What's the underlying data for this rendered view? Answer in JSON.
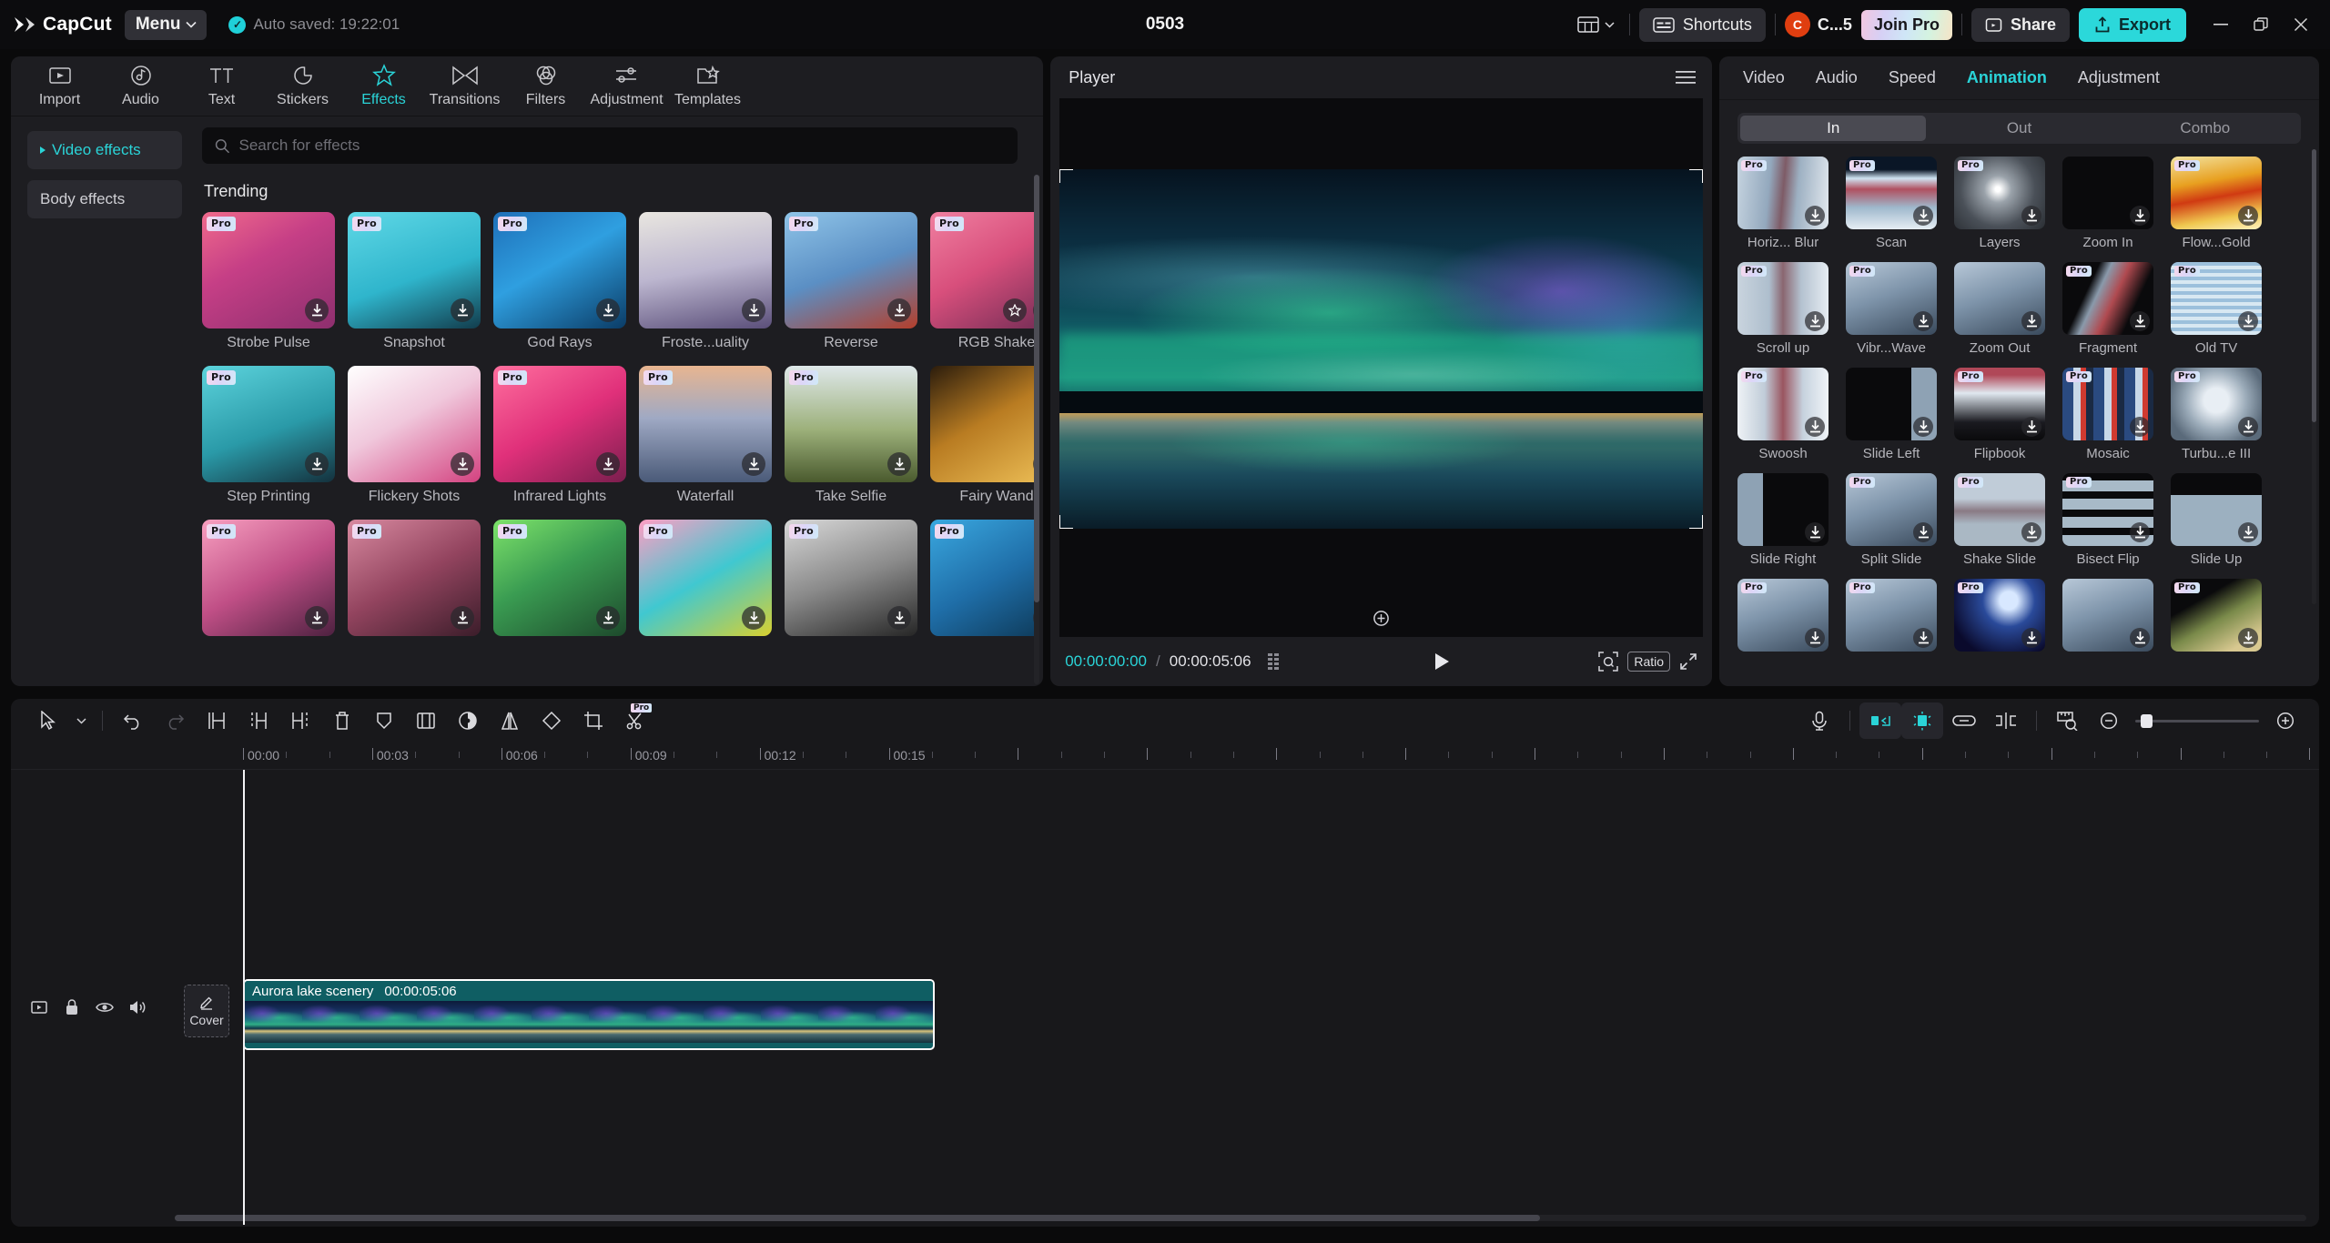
{
  "topbar": {
    "brand": "CapCut",
    "menu_label": "Menu",
    "autosave_text": "Auto saved: 19:22:01",
    "project_title": "0503",
    "shortcuts_label": "Shortcuts",
    "account_initial": "C",
    "account_name": "C...5",
    "join_pro_label": "Join Pro",
    "share_label": "Share",
    "export_label": "Export",
    "accent_cyan": "#2bd8da",
    "avatar_color": "#e03e10"
  },
  "left_panel": {
    "tabs": [
      {
        "label": "Import",
        "icon": "import-icon",
        "active": false
      },
      {
        "label": "Audio",
        "icon": "audio-icon",
        "active": false
      },
      {
        "label": "Text",
        "icon": "text-icon",
        "active": false
      },
      {
        "label": "Stickers",
        "icon": "stickers-icon",
        "active": false
      },
      {
        "label": "Effects",
        "icon": "effects-icon",
        "active": true
      },
      {
        "label": "Transitions",
        "icon": "transitions-icon",
        "active": false
      },
      {
        "label": "Filters",
        "icon": "filters-icon",
        "active": false
      },
      {
        "label": "Adjustment",
        "icon": "adjustment-icon",
        "active": false
      },
      {
        "label": "Templates",
        "icon": "templates-icon",
        "active": false
      }
    ],
    "sidebar": [
      {
        "label": "Video effects",
        "active": true
      },
      {
        "label": "Body effects",
        "active": false
      }
    ],
    "search": {
      "placeholder": "Search for effects",
      "value": "",
      "icon": "search-icon"
    },
    "section_title": "Trending",
    "effects": [
      {
        "name": "Strobe Pulse",
        "pro": true,
        "fav": false,
        "download": true
      },
      {
        "name": "Snapshot",
        "pro": true,
        "fav": false,
        "download": true
      },
      {
        "name": "God Rays",
        "pro": true,
        "fav": false,
        "download": true
      },
      {
        "name": "Froste...uality",
        "pro": false,
        "fav": false,
        "download": true
      },
      {
        "name": "Reverse",
        "pro": true,
        "fav": false,
        "download": true
      },
      {
        "name": "RGB Shake",
        "pro": true,
        "fav": true,
        "download": true
      },
      {
        "name": "Step Printing",
        "pro": true,
        "fav": false,
        "download": true
      },
      {
        "name": "Flickery Shots",
        "pro": false,
        "fav": false,
        "download": true
      },
      {
        "name": "Infrared Lights",
        "pro": true,
        "fav": false,
        "download": true
      },
      {
        "name": "Waterfall",
        "pro": true,
        "fav": false,
        "download": true
      },
      {
        "name": "Take Selfie",
        "pro": true,
        "fav": false,
        "download": true
      },
      {
        "name": "Fairy Wand",
        "pro": false,
        "fav": false,
        "download": true
      },
      {
        "name": "",
        "pro": true,
        "fav": false,
        "download": true
      },
      {
        "name": "",
        "pro": true,
        "fav": false,
        "download": true
      },
      {
        "name": "",
        "pro": true,
        "fav": false,
        "download": true
      },
      {
        "name": "",
        "pro": true,
        "fav": false,
        "download": true
      },
      {
        "name": "",
        "pro": true,
        "fav": false,
        "download": true
      },
      {
        "name": "",
        "pro": true,
        "fav": false,
        "download": true
      }
    ]
  },
  "player": {
    "title": "Player",
    "menu_icon": "hamburger-icon",
    "current_time": "00:00:00:00",
    "time_separator": "/",
    "total_time": "00:00:05:06",
    "grid_icon": "frames-icon",
    "play_icon": "play-icon",
    "quality_icon": "quality-icon",
    "ratio_label": "Ratio",
    "fullscreen_icon": "fullscreen-icon",
    "reset_icon": "reset-icon"
  },
  "right_panel": {
    "tabs": [
      {
        "label": "Video",
        "active": false
      },
      {
        "label": "Audio",
        "active": false
      },
      {
        "label": "Speed",
        "active": false
      },
      {
        "label": "Animation",
        "active": true
      },
      {
        "label": "Adjustment",
        "active": false
      }
    ],
    "segments": [
      {
        "label": "In",
        "active": true
      },
      {
        "label": "Out",
        "active": false
      },
      {
        "label": "Combo",
        "active": false
      }
    ],
    "animations": [
      {
        "name": "Horiz... Blur",
        "pro": true,
        "style": "blur-h"
      },
      {
        "name": "Scan",
        "pro": true,
        "style": "scan"
      },
      {
        "name": "Layers",
        "pro": true,
        "style": "layers"
      },
      {
        "name": "Zoom In",
        "pro": false,
        "style": "zoomin"
      },
      {
        "name": "Flow...Gold",
        "pro": true,
        "style": "gold"
      },
      {
        "name": "Scroll up",
        "pro": true,
        "style": "scrollup"
      },
      {
        "name": "Vibr...Wave",
        "pro": true,
        "style": "plain"
      },
      {
        "name": "Zoom Out",
        "pro": false,
        "style": "plain"
      },
      {
        "name": "Fragment",
        "pro": true,
        "style": "fragment"
      },
      {
        "name": "Old TV",
        "pro": true,
        "style": "oldtv"
      },
      {
        "name": "Swoosh",
        "pro": true,
        "style": "swoosh"
      },
      {
        "name": "Slide Left",
        "pro": false,
        "style": "slideleft"
      },
      {
        "name": "Flipbook",
        "pro": true,
        "style": "flipbook"
      },
      {
        "name": "Mosaic",
        "pro": true,
        "style": "mosaic"
      },
      {
        "name": "Turbu...e III",
        "pro": true,
        "style": "turbu"
      },
      {
        "name": "Slide Right",
        "pro": false,
        "style": "slideright"
      },
      {
        "name": "Split Slide",
        "pro": true,
        "style": "plain"
      },
      {
        "name": "Shake Slide",
        "pro": true,
        "style": "shake"
      },
      {
        "name": "Bisect Flip",
        "pro": true,
        "style": "bisect"
      },
      {
        "name": "Slide Up",
        "pro": false,
        "style": "slideup"
      },
      {
        "name": "",
        "pro": true,
        "style": "plain"
      },
      {
        "name": "",
        "pro": true,
        "style": "plain"
      },
      {
        "name": "",
        "pro": true,
        "style": "space"
      },
      {
        "name": "",
        "pro": false,
        "style": "plain"
      },
      {
        "name": "",
        "pro": true,
        "style": "warm"
      }
    ]
  },
  "timeline": {
    "tools": [
      {
        "name": "select-tool",
        "icon": "cursor-icon",
        "state": "normal"
      },
      {
        "name": "undo",
        "icon": "undo-icon",
        "state": "normal"
      },
      {
        "name": "redo",
        "icon": "redo-icon",
        "state": "dim"
      },
      {
        "name": "split",
        "icon": "split-icon",
        "state": "normal"
      },
      {
        "name": "trim-left",
        "icon": "trim-left-icon",
        "state": "normal"
      },
      {
        "name": "trim-right",
        "icon": "trim-right-icon",
        "state": "normal"
      },
      {
        "name": "delete",
        "icon": "trash-icon",
        "state": "normal"
      },
      {
        "name": "marker",
        "icon": "marker-icon",
        "state": "normal"
      },
      {
        "name": "mirror",
        "icon": "mirror-icon",
        "state": "normal"
      },
      {
        "name": "freeze",
        "icon": "freeze-icon",
        "state": "normal"
      },
      {
        "name": "flip",
        "icon": "flip-icon",
        "state": "normal"
      },
      {
        "name": "rotate",
        "icon": "rotate-icon",
        "state": "normal"
      },
      {
        "name": "crop",
        "icon": "crop-icon",
        "state": "normal"
      },
      {
        "name": "smart-cutout",
        "icon": "cutout-icon",
        "state": "pro"
      }
    ],
    "pro_tag": "Pro",
    "right_tools": [
      {
        "name": "record-voiceover",
        "icon": "mic-icon",
        "state": "normal"
      },
      {
        "name": "auto-snap",
        "icon": "snap-icon",
        "state": "on"
      },
      {
        "name": "magnet-adsorb",
        "icon": "adsorb-icon",
        "state": "on"
      },
      {
        "name": "link-clips",
        "icon": "link-icon",
        "state": "normal"
      },
      {
        "name": "toggle-preview",
        "icon": "split-preview-icon",
        "state": "normal"
      },
      {
        "name": "fit-timeline",
        "icon": "ruler-icon",
        "state": "normal"
      }
    ],
    "zoom_out_icon": "zoom-out-icon",
    "zoom_in_icon": "zoom-in-icon",
    "ruler_labels": [
      "00:00",
      "00:03",
      "00:06",
      "00:09",
      "00:12",
      "00:15"
    ],
    "playhead_time": "00:00",
    "track_controls": [
      {
        "name": "track-video-icon",
        "icon": "video-icon"
      },
      {
        "name": "track-lock",
        "icon": "lock-icon"
      },
      {
        "name": "track-visibility",
        "icon": "eye-icon"
      },
      {
        "name": "track-mute",
        "icon": "speaker-icon"
      }
    ],
    "cover_label": "Cover",
    "cover_icon": "pencil-icon",
    "clip": {
      "name": "Aurora lake scenery",
      "duration": "00:00:05:06",
      "selected": true,
      "color": "#0f5e63"
    }
  }
}
